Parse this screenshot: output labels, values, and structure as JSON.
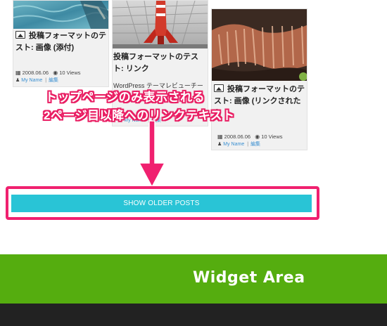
{
  "cards": [
    {
      "title": "投稿フォーマットのテスト: 画像 (添付)",
      "date": "2008.06.06",
      "views": "10 Views",
      "author": "My Name",
      "edit": "編集"
    },
    {
      "title": "投稿フォーマットのテスト: リンク",
      "excerpt": "WordPress テーマレビューチー",
      "author": "My Name",
      "edit": "編集"
    },
    {
      "title": "投稿フォーマットのテスト: 画像 (リンクされたも",
      "date": "2008.06.06",
      "views": "10 Views",
      "author": "My Name",
      "edit": "編集"
    }
  ],
  "annotation": {
    "line1": "トップページのみ表示される",
    "line2": "2ページ目以降へのリンクテキスト",
    "color": "#e91e63"
  },
  "pagination": {
    "older_posts_label": "SHOW OLDER POSTS",
    "button_color": "#29c4d6"
  },
  "widget_area": {
    "title": "Widget Area",
    "color": "#55ad0f"
  }
}
